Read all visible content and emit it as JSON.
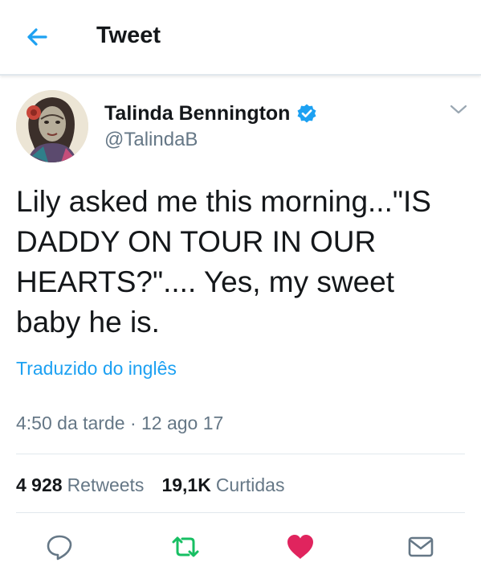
{
  "header": {
    "title": "Tweet",
    "back_icon": "back-arrow-icon"
  },
  "author": {
    "name": "Talinda Bennington",
    "handle": "@TalindaB",
    "verified": true
  },
  "tweet": {
    "text": "Lily asked me this morning...\"IS DADDY ON TOUR IN OUR HEARTS?\".... Yes, my sweet baby he is.",
    "translate_label": "Traduzido do inglês",
    "timestamp": "4:50 da tarde · 12 ago 17"
  },
  "stats": {
    "retweets_count": "4 928",
    "retweets_label": "Retweets",
    "likes_count": "19,1K",
    "likes_label": "Curtidas"
  },
  "actions": {
    "reply_icon": "reply-icon",
    "retweet_icon": "retweet-icon",
    "like_icon": "heart-icon",
    "dm_icon": "mail-icon"
  },
  "colors": {
    "accent": "#1da1f2",
    "retweet": "#17bf63",
    "like": "#e0245e",
    "secondary_text": "#657786",
    "divider": "#e1e8ed"
  }
}
